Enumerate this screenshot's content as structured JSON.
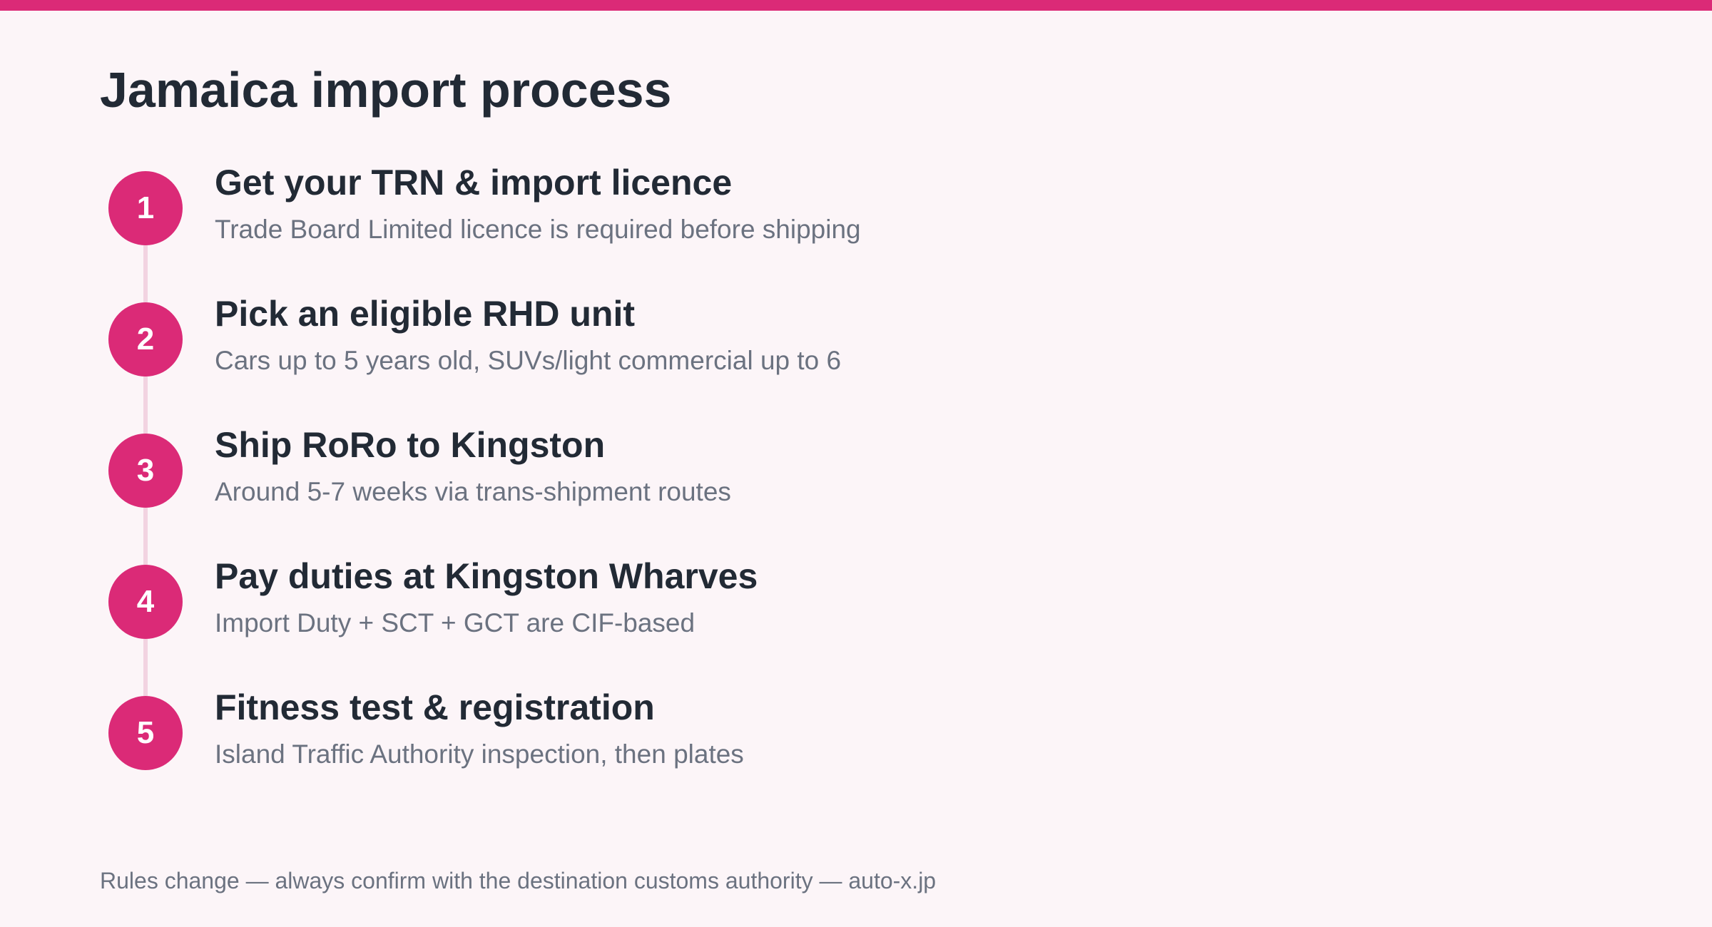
{
  "colors": {
    "accent": "#db2a77",
    "background": "#fcf5f8",
    "connector": "#f2d3e1",
    "title_text": "#222a35",
    "muted_text": "#6b7280"
  },
  "page": {
    "title": "Jamaica import process"
  },
  "steps": [
    {
      "number": "1",
      "title": "Get your TRN & import licence",
      "description": "Trade Board Limited licence is required before shipping"
    },
    {
      "number": "2",
      "title": "Pick an eligible RHD unit",
      "description": "Cars up to 5 years old, SUVs/light commercial up to 6"
    },
    {
      "number": "3",
      "title": "Ship RoRo to Kingston",
      "description": "Around 5-7 weeks via trans-shipment routes"
    },
    {
      "number": "4",
      "title": "Pay duties at Kingston Wharves",
      "description": "Import Duty + SCT + GCT are CIF-based"
    },
    {
      "number": "5",
      "title": "Fitness test & registration",
      "description": "Island Traffic Authority inspection, then plates"
    }
  ],
  "footer": {
    "note": "Rules change — always confirm with the destination customs authority — auto-x.jp"
  }
}
